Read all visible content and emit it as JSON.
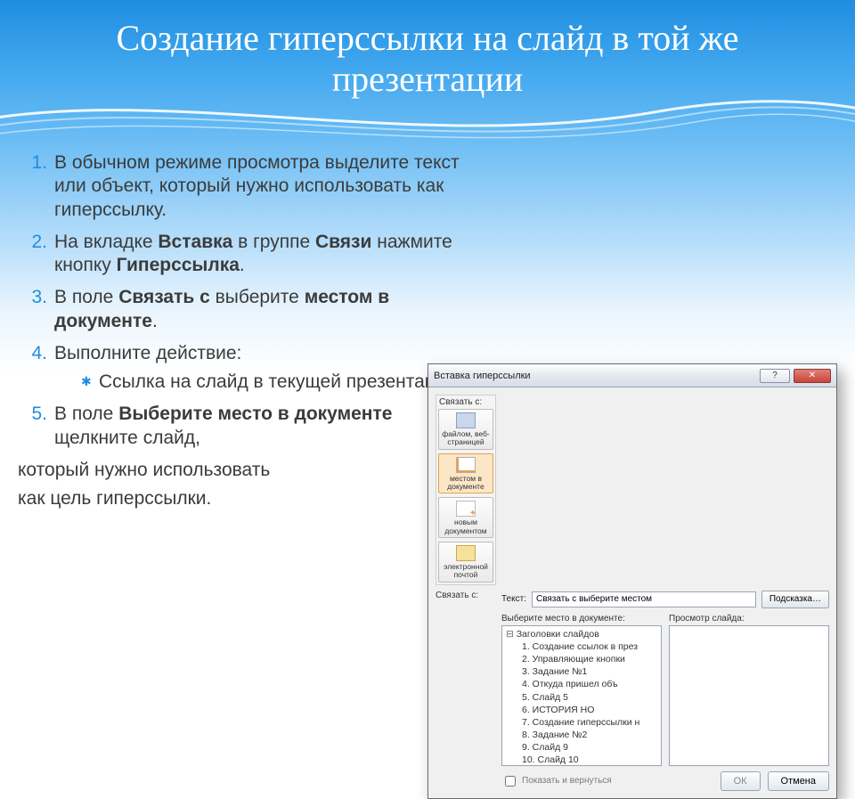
{
  "slide": {
    "title": "Создание гиперссылки на слайд в той же презентации",
    "steps": {
      "s1": "В обычном режиме просмотра выделите текст или объект, который нужно использовать как гиперссылку.",
      "s2_a": "На вкладке ",
      "s2_b1": "Вставка",
      "s2_c": " в группе ",
      "s2_b2": "Связи",
      "s2_d": " нажмите кнопку ",
      "s2_b3": "Гиперссылка",
      "s2_e": ".",
      "s3_a": "В поле ",
      "s3_b1": "Связать с",
      "s3_c": " выберите ",
      "s3_b2": "местом в документе",
      "s3_d": ".",
      "s4": "Выполните действие:",
      "s4_sub": "Ссылка на слайд в текущей презентации.",
      "s5_a": "В поле ",
      "s5_b1": "Выберите место в документе",
      "s5_c": " щелкните слайд,",
      "tail1": "который нужно использовать",
      "tail2": "как цель гиперссылки."
    }
  },
  "dialog": {
    "title": "Вставка гиперссылки",
    "linkto_label": "Связать с:",
    "linkto": {
      "web": "файлом, веб-страницей",
      "doc": "местом в документе",
      "new": "новым документом",
      "mail": "электронной почтой"
    },
    "text_label": "Текст:",
    "text_value": "Связать с выберите местом",
    "hint_button": "Подсказка…",
    "select_label": "Выберите место в документе:",
    "preview_label": "Просмотр слайда:",
    "tree": {
      "root": "Заголовки слайдов",
      "items": [
        "1. Создание ссылок в през",
        "2. Управляющие кнопки",
        "3. Задание №1",
        "4. Откуда пришел        объ",
        "5. Слайд 5",
        "6.        ИСТОРИЯ      НО",
        "7. Создание гиперссылки н",
        "8. Задание №2",
        "9. Слайд 9",
        "10. Слайд 10"
      ]
    },
    "show_return": "Показать и вернуться",
    "ok": "ОК",
    "cancel": "Отмена"
  }
}
